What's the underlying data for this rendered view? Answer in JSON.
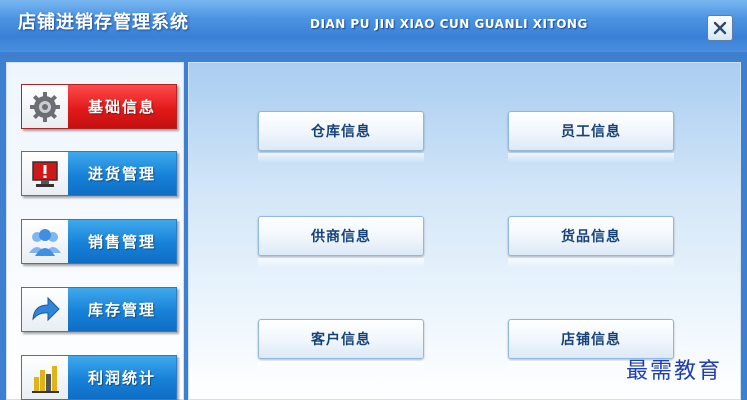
{
  "window": {
    "title": "店铺进销存管理系统",
    "subtitle": "DIAN PU JIN XIAO CUN GUANLI XITONG",
    "close_icon": "close-icon"
  },
  "sidebar": {
    "items": [
      {
        "label": "基础信息",
        "icon": "gear-icon",
        "active": true
      },
      {
        "label": "进货管理",
        "icon": "computer-alert-icon",
        "active": false
      },
      {
        "label": "销售管理",
        "icon": "users-icon",
        "active": false
      },
      {
        "label": "库存管理",
        "icon": "arrow-right-icon",
        "active": false
      },
      {
        "label": "利润统计",
        "icon": "bar-chart-icon",
        "active": false
      }
    ]
  },
  "main": {
    "buttons": [
      {
        "label": "仓库信息"
      },
      {
        "label": "员工信息"
      },
      {
        "label": "供商信息"
      },
      {
        "label": "货品信息"
      },
      {
        "label": "客户信息"
      },
      {
        "label": "店铺信息"
      }
    ]
  },
  "watermark": "最需教育",
  "colors": {
    "accent_blue": "#1781d8",
    "active_red": "#e21b1b",
    "button_text": "#16427a"
  }
}
